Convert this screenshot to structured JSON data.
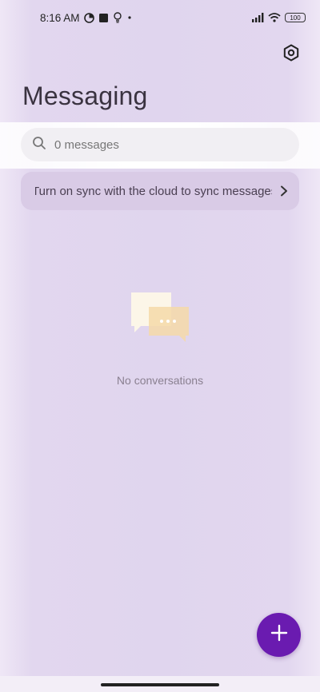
{
  "status_bar": {
    "time": "8:16 AM",
    "battery": "100"
  },
  "header": {
    "title": "Messaging"
  },
  "search": {
    "placeholder": "0 messages"
  },
  "sync_banner": {
    "text": "Turn on sync with the cloud to sync messages"
  },
  "empty_state": {
    "text": "No conversations"
  },
  "colors": {
    "accent": "#6a1bb0",
    "background": "#e2d7ef"
  }
}
